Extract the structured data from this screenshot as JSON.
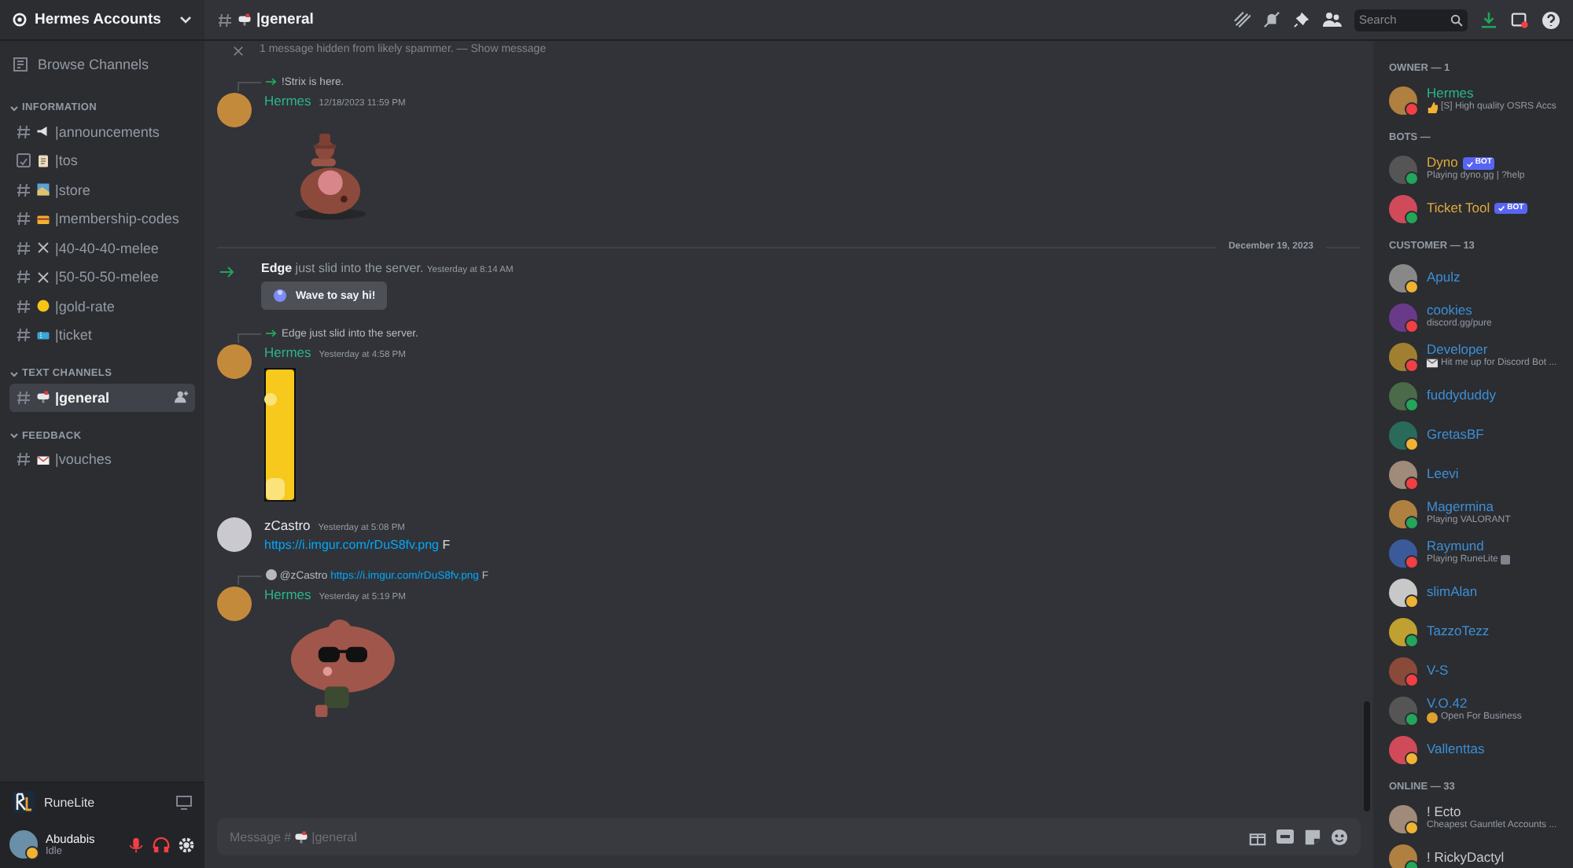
{
  "server": {
    "name": "Hermes Accounts"
  },
  "browse": {
    "label": "Browse Channels"
  },
  "categories": [
    {
      "name": "INFORMATION",
      "expanded": true,
      "channels": [
        {
          "name": "|announcements",
          "rules": false,
          "kind": "megaphone",
          "selected": false
        },
        {
          "name": "|tos",
          "rules": true,
          "kind": "clipboard",
          "selected": false
        },
        {
          "name": "|store",
          "rules": false,
          "kind": "map",
          "selected": false
        },
        {
          "name": "|membership-codes",
          "rules": false,
          "kind": "card",
          "selected": false
        },
        {
          "name": "|40-40-40-melee",
          "rules": false,
          "kind": "swords",
          "selected": false
        },
        {
          "name": "|50-50-50-melee",
          "rules": false,
          "kind": "swords",
          "selected": false
        },
        {
          "name": "|gold-rate",
          "rules": false,
          "kind": "coin",
          "selected": false
        },
        {
          "name": "|ticket",
          "rules": false,
          "kind": "ticket",
          "selected": false
        }
      ]
    },
    {
      "name": "TEXT CHANNELS",
      "expanded": true,
      "channels": [
        {
          "name": "|general",
          "rules": false,
          "kind": "mailbox",
          "selected": true
        }
      ]
    },
    {
      "name": "FEEDBACK",
      "expanded": true,
      "channels": [
        {
          "name": "|vouches",
          "rules": false,
          "kind": "envelope",
          "selected": false
        }
      ]
    }
  ],
  "activity": {
    "name": "RuneLite"
  },
  "user": {
    "name": "Abudabis",
    "status_text": "Idle",
    "color": "#f0b232",
    "muted": true,
    "deafened": true
  },
  "header": {
    "channel": "|general",
    "search_placeholder": "Search"
  },
  "messages": [
    {
      "kind": "hidden",
      "text": "1 message hidden from likely spammer. —",
      "link": "Show message"
    },
    {
      "kind": "message",
      "reply": {
        "text": "!Strix is here."
      },
      "author": "Hermes",
      "color": "#2bb58c",
      "time": "12/18/2023 11:59 PM"
    },
    {
      "kind": "divider",
      "text": "December 19, 2023"
    },
    {
      "kind": "join",
      "user": "Edge",
      "text": "just slid into the server.",
      "time": "Yesterday at 8:14 AM",
      "button": "Wave to say hi!"
    },
    {
      "kind": "message",
      "reply": {
        "text": "Edge just slid into the server."
      },
      "author": "Hermes",
      "color": "#2bb58c",
      "time": "Yesterday at 4:58 PM"
    },
    {
      "kind": "message",
      "author": "zCastro",
      "color": "#e6e7ea",
      "time": "Yesterday at 5:08 PM",
      "content": {
        "link": "https://i.imgur.com/rDuS8fv.png",
        "text": "F"
      }
    },
    {
      "kind": "message",
      "reply": {
        "mention": "@zCastro",
        "link": "https://i.imgur.com/rDuS8fv.png",
        "text": "F"
      },
      "author": "Hermes",
      "color": "#2bb58c",
      "time": "Yesterday at 5:19 PM"
    }
  ],
  "composer": {
    "placeholder": "Message #",
    "channel": "|general"
  },
  "member_groups": [
    {
      "title": "OWNER — 1",
      "color": "#2bb58c",
      "members": [
        {
          "name": "Hermes",
          "color": "#f23f43",
          "kind": "thumb",
          "activity": "[S] High quality OSRS Accs"
        }
      ]
    },
    {
      "title": "BOTS —",
      "color": "#e0a93a",
      "members": [
        {
          "name": "Dyno",
          "color": "#23a55a",
          "tag": "BOT",
          "activity": "Playing dyno.gg | ?help"
        },
        {
          "name": "Ticket Tool",
          "color": "#23a55a",
          "tag": "BOT"
        }
      ]
    },
    {
      "title": "CUSTOMER — 13",
      "color": "#3d8fd6",
      "members": [
        {
          "name": "Apulz",
          "color": "#f0b232"
        },
        {
          "name": "cookies",
          "color": "#f23f43",
          "activity": "discord.gg/pure"
        },
        {
          "name": "Developer",
          "color": "#f23f43",
          "kind": "mail",
          "activity": "Hit me up for Discord Bot ..."
        },
        {
          "name": "fuddyduddy",
          "color": "#23a55a"
        },
        {
          "name": "GretasBF",
          "color": "#f0b232"
        },
        {
          "name": "Leevi",
          "color": "#f23f43"
        },
        {
          "name": "Magermina",
          "color": "#23a55a",
          "activity": "Playing VALORANT"
        },
        {
          "name": "Raymund",
          "color": "#f23f43",
          "activity": "Playing RuneLite",
          "activity_badge": true
        },
        {
          "name": "slimAlan",
          "color": "#f0b232"
        },
        {
          "name": "TazzoTezz",
          "color": "#23a55a"
        },
        {
          "name": "V-S",
          "color": "#f23f43"
        },
        {
          "name": "V.O.42",
          "color": "#23a55a",
          "kind": "emoji",
          "activity": "Open For Business"
        },
        {
          "name": "Vallenttas",
          "color": "#f0b232"
        }
      ]
    },
    {
      "title": "ONLINE — 33",
      "color": "#c9cacd",
      "members": [
        {
          "name": "! Ecto",
          "color": "#f0b232",
          "activity": "Cheapest Gauntlet Accounts ..."
        },
        {
          "name": "! RickyDactyl",
          "color": "#23a55a"
        }
      ]
    }
  ]
}
